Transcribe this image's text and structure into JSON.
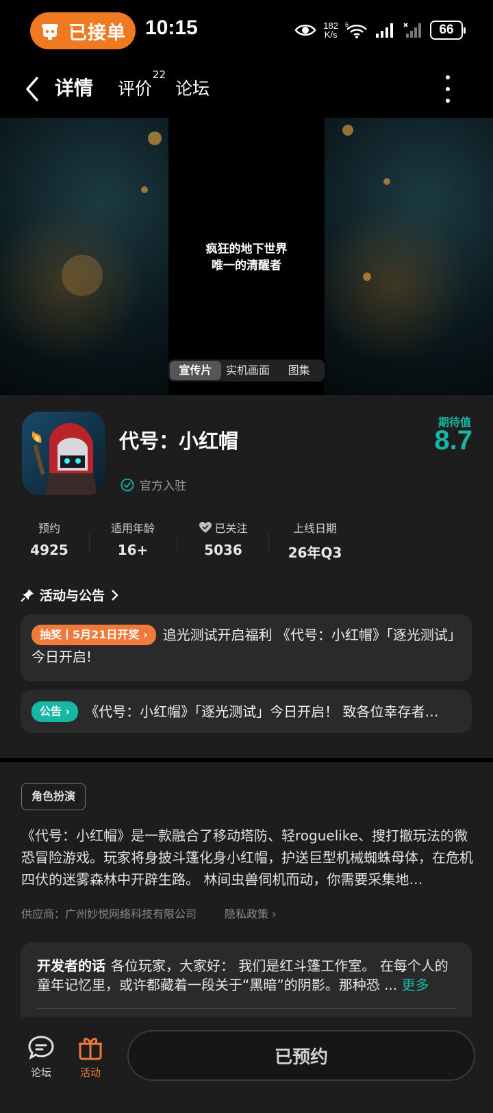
{
  "status_bar": {
    "order_label": "已接单",
    "time": "10:15",
    "net_speed": "182",
    "net_speed_unit": "K/s",
    "wifi_badge": "6",
    "battery": "66"
  },
  "nav": {
    "tabs": [
      {
        "label": "详情",
        "active": true
      },
      {
        "label": "评价",
        "count": "22"
      },
      {
        "label": "论坛"
      }
    ]
  },
  "media": {
    "slogan_line1": "疯狂的地下世界",
    "slogan_line2": "唯一的清醒者",
    "tabs": [
      "宣传片",
      "实机画面",
      "图集"
    ],
    "active_tab": "宣传片"
  },
  "game": {
    "title": "代号：小红帽",
    "official_label": "官方入驻",
    "expect_label": "期待值",
    "expect_score": "8.7",
    "stats": [
      {
        "label": "预约",
        "value": "4925"
      },
      {
        "label": "适用年龄",
        "value": "16+"
      },
      {
        "label": "已关注",
        "value": "5036"
      },
      {
        "label": "上线日期",
        "value": "26年Q3"
      }
    ]
  },
  "announcements": {
    "header": "活动与公告",
    "items": [
      {
        "badge": "抽奖丨5月21日开奖",
        "text": "追光测试开启福利 《代号：小红帽》「逐光测试」今日开启!"
      },
      {
        "badge": "公告",
        "text": "《代号：小红帽》「逐光测试」今日开启！ 致各位幸存者…"
      }
    ]
  },
  "description": {
    "genre": "角色扮演",
    "text": "《代号：小红帽》是一款融合了移动塔防、轻roguelike、搜打撤玩法的微恐冒险游戏。玩家将身披斗篷化身小红帽，护送巨型机械蜘蛛母体，在危机四伏的迷雾森林中开辟生路。 林间虫兽伺机而动，你需要采集地…",
    "supplier": "供应商：广州妙悦网络科技有限公司",
    "privacy": "隐私政策"
  },
  "developer": {
    "title": "开发者的话",
    "text": "各位玩家，大家好： 我们是红斗篷工作室。 在每个人的童年记忆里，或许都藏着一段关于“黑暗”的阴影。那种恐 ...",
    "more": "更多"
  },
  "bottom_bar": {
    "forum_label": "论坛",
    "activity_label": "活动",
    "reserve_label": "已预约"
  },
  "colors": {
    "accent": "#18b7a5",
    "orange": "#f07a3a",
    "background": "#1d1d1d"
  }
}
